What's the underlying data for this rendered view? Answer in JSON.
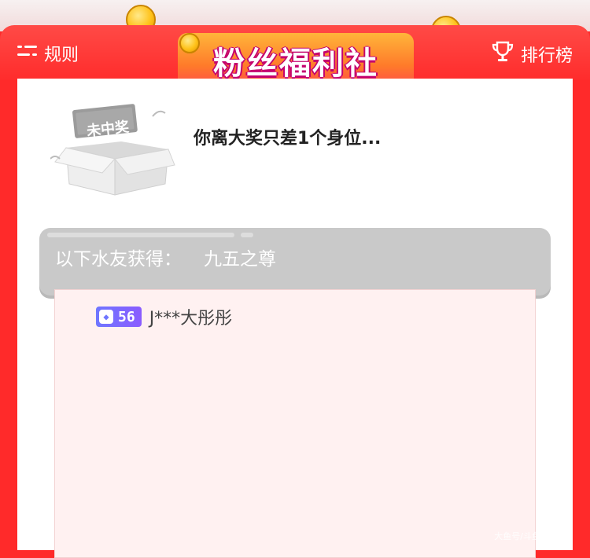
{
  "header": {
    "title": "粉丝福利社",
    "rules_label": "规则",
    "leaderboard_label": "排行榜"
  },
  "result": {
    "status_tag": "未中奖",
    "message": "你离大奖只差1个身位..."
  },
  "winners": {
    "label": "以下水友获得：",
    "prize": "九五之尊",
    "list": [
      {
        "level": "56",
        "name": "J***大彤彤"
      }
    ]
  },
  "watermark": "大鱼号/斗鱼大事件",
  "colors": {
    "background_red": "#ff2a2a",
    "badge_purple": "#6f76ff",
    "card_grey": "#c9c9c9",
    "paper_pink": "#fff1f1"
  },
  "icons": {
    "rules": "menu-icon",
    "leaderboard": "trophy-icon",
    "level": "shield-icon"
  }
}
